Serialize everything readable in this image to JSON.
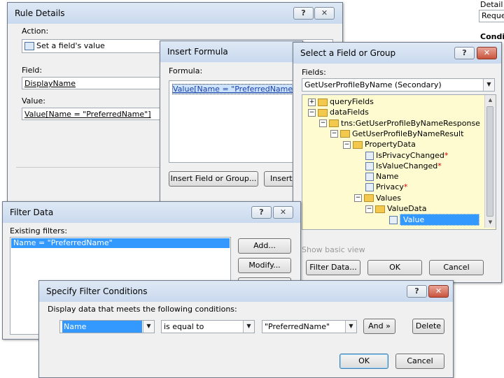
{
  "rule_details": {
    "title": "Rule Details",
    "action_label": "Action:",
    "action_value": "Set a field's value",
    "field_label": "Field:",
    "field_value": "DisplayName",
    "value_label": "Value:",
    "value_value": "Value[Name = \"PreferredName\"]"
  },
  "bg_right": {
    "detail_text": "Detail",
    "reque_text": "Reque",
    "condit_text": "Condit"
  },
  "insert_formula": {
    "title": "Insert Formula",
    "formula_label": "Formula:",
    "formula_value": "Value[Name = \"PreferredName\"]",
    "insert_field_button": "Insert Field or Group...",
    "insert_function_button": "Insert"
  },
  "select_field": {
    "title": "Select a Field or Group",
    "fields_label": "Fields:",
    "datasource_value": "GetUserProfileByName (Secondary)",
    "tree": [
      {
        "label": "queryFields",
        "kind": "folder",
        "expander": "+"
      },
      {
        "label": "dataFields",
        "kind": "folder",
        "expander": "−"
      },
      {
        "label": "tns:GetUserProfileByNameResponse",
        "kind": "folder",
        "expander": "−"
      },
      {
        "label": "GetUserProfileByNameResult",
        "kind": "folder",
        "expander": "−"
      },
      {
        "label": "PropertyData",
        "kind": "group",
        "expander": "−"
      },
      {
        "label": "IsPrivacyChanged",
        "kind": "field",
        "required": "*"
      },
      {
        "label": "IsValueChanged",
        "kind": "field",
        "required": "*"
      },
      {
        "label": "Name",
        "kind": "field",
        "required": ""
      },
      {
        "label": "Privacy",
        "kind": "field",
        "required": "*"
      },
      {
        "label": "Values",
        "kind": "group",
        "expander": "−"
      },
      {
        "label": "ValueData",
        "kind": "group",
        "expander": "−"
      },
      {
        "label": "Value",
        "kind": "field",
        "required": "",
        "selected": true
      }
    ],
    "show_basic_view": "Show basic view",
    "filter_data_button": "Filter Data...",
    "ok_button": "OK",
    "cancel_button": "Cancel"
  },
  "filter_data": {
    "title": "Filter Data",
    "existing_label": "Existing filters:",
    "filters": [
      "Name = \"PreferredName\""
    ],
    "add_button": "Add...",
    "modify_button": "Modify..."
  },
  "specify_filter": {
    "title": "Specify Filter Conditions",
    "instructions": "Display data that meets the following conditions:",
    "field_select": "Name",
    "operator_select": "is equal to",
    "value_select": "\"PreferredName\"",
    "and_button": "And »",
    "delete_button": "Delete",
    "ok_button": "OK",
    "cancel_button": "Cancel"
  },
  "title_buttons": {
    "help": "?",
    "close": "✕"
  },
  "colors": {
    "selection": "#3399ff",
    "tree_bg": "#fefbd0",
    "required": "#e00000"
  }
}
